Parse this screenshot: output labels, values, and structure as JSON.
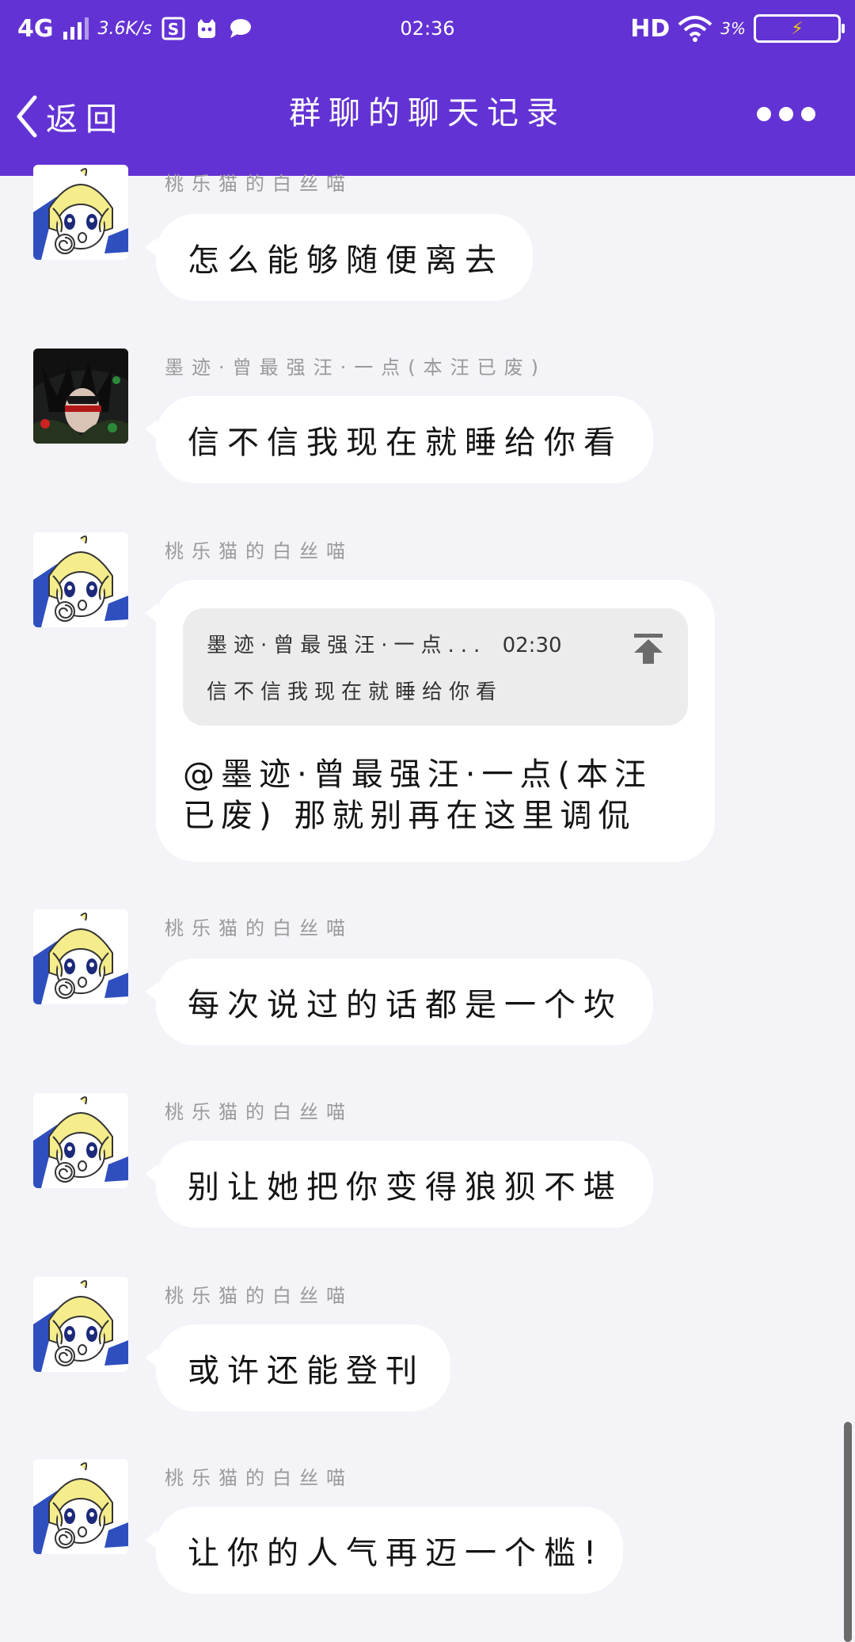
{
  "status_bar": {
    "network": "4G",
    "speed": "3.6K/s",
    "time": "02:36",
    "hd": "HD",
    "battery_pct": "3%",
    "battery_level": 0.03
  },
  "nav": {
    "back_label": "返回",
    "title": "群聊的聊天记录"
  },
  "messages": [
    {
      "sender": "桃乐猫的白丝喵",
      "text": "怎么能够随便离去",
      "avatar": "cartoon-girl"
    },
    {
      "sender": "墨迹·曾最强汪·一点(本汪已废)",
      "text": "信不信我现在就睡给你看",
      "avatar": "dark-hair-boy"
    },
    {
      "sender": "桃乐猫的白丝喵",
      "avatar": "cartoon-girl",
      "quote": {
        "from": "墨迹·曾最强汪·一点...",
        "time": "02:30",
        "text": "信不信我现在就睡给你看"
      },
      "text": "@墨迹·曾最强汪·一点(本汪已废) 那就别再在这里调侃"
    },
    {
      "sender": "桃乐猫的白丝喵",
      "text": "每次说过的话都是一个坎",
      "avatar": "cartoon-girl"
    },
    {
      "sender": "桃乐猫的白丝喵",
      "text": "别让她把你变得狼狈不堪",
      "avatar": "cartoon-girl"
    },
    {
      "sender": "桃乐猫的白丝喵",
      "text": "或许还能登刊",
      "avatar": "cartoon-girl"
    },
    {
      "sender": "桃乐猫的白丝喵",
      "text": "让你的人气再迈一个槛!",
      "avatar": "cartoon-girl"
    }
  ]
}
